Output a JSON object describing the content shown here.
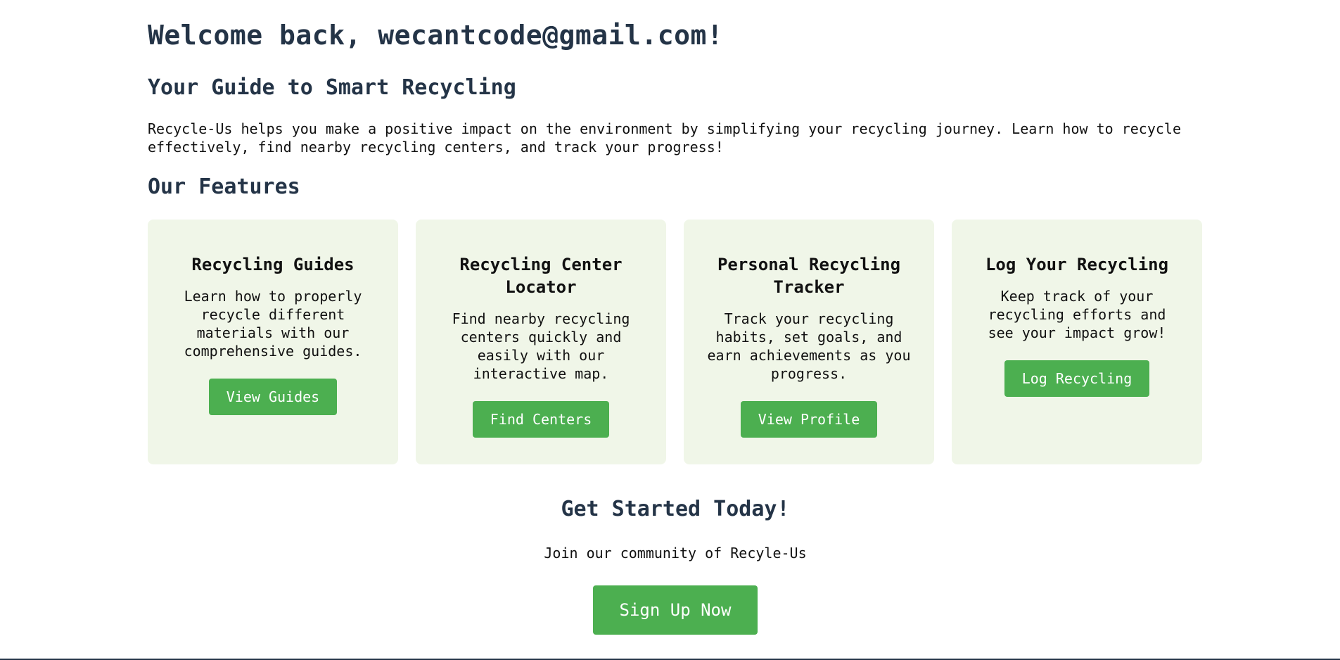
{
  "header": {
    "welcome": "Welcome back, wecantcode@gmail.com!"
  },
  "intro": {
    "title": "Your Guide to Smart Recycling",
    "description": "Recycle-Us helps you make a positive impact on the environment by simplifying your recycling journey. Learn how to recycle effectively, find nearby recycling centers, and track your progress!"
  },
  "features": {
    "title": "Our Features",
    "cards": [
      {
        "title": "Recycling Guides",
        "description": "Learn how to properly recycle different materials with our comprehensive guides.",
        "button": "View Guides"
      },
      {
        "title": "Recycling Center Locator",
        "description": "Find nearby recycling centers quickly and easily with our interactive map.",
        "button": "Find Centers"
      },
      {
        "title": "Personal Recycling Tracker",
        "description": "Track your recycling habits, set goals, and earn achievements as you progress.",
        "button": "View Profile"
      },
      {
        "title": "Log Your Recycling",
        "description": "Keep track of your recycling efforts and see your impact grow!",
        "button": "Log Recycling"
      }
    ]
  },
  "cta": {
    "title": "Get Started Today!",
    "subtitle": "Join our community of Recyle-Us",
    "button": "Sign Up Now"
  },
  "colors": {
    "heading": "#243447",
    "accent": "#4caf50",
    "card_background": "#f0f6e8"
  }
}
